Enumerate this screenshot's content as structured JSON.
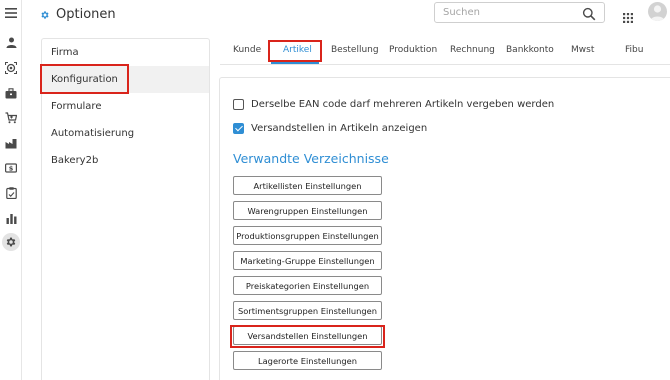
{
  "header": {
    "title": "Optionen",
    "search_placeholder": "Suchen"
  },
  "rail_icons": [
    "menu-icon",
    "person-icon",
    "target-icon",
    "briefcase-icon",
    "cart-icon",
    "factory-icon",
    "money-icon",
    "clipboard-icon",
    "bar-chart-icon",
    "gear-icon"
  ],
  "menu": {
    "items": [
      {
        "label": "Firma"
      },
      {
        "label": "Konfiguration"
      },
      {
        "label": "Formulare"
      },
      {
        "label": "Automatisierung"
      },
      {
        "label": "Bakery2b"
      }
    ],
    "selected": "Konfiguration"
  },
  "tabs": [
    {
      "label": "Kunde"
    },
    {
      "label": "Artikel"
    },
    {
      "label": "Bestellung"
    },
    {
      "label": "Produktion"
    },
    {
      "label": "Rechnung"
    },
    {
      "label": "Bankkonto"
    },
    {
      "label": "Mwst"
    },
    {
      "label": "Fibu"
    }
  ],
  "active_tab": "Artikel",
  "settings": {
    "checkboxes": [
      {
        "label": "Derselbe EAN code darf mehreren Artikeln vergeben werden",
        "checked": false
      },
      {
        "label": "Versandstellen in Artikeln anzeigen",
        "checked": true
      }
    ],
    "section_title": "Verwandte Verzeichnisse",
    "buttons": [
      {
        "label": "Artikellisten Einstellungen"
      },
      {
        "label": "Warengruppen Einstellungen"
      },
      {
        "label": "Produktionsgruppen Einstellungen"
      },
      {
        "label": "Marketing-Gruppe Einstellungen"
      },
      {
        "label": "Preiskategorien Einstellungen"
      },
      {
        "label": "Sortimentsgruppen Einstellungen"
      },
      {
        "label": "Versandstellen Einstellungen"
      },
      {
        "label": "Lagerorte Einstellungen"
      }
    ]
  },
  "colors": {
    "accent": "#2f8ed4",
    "highlight": "#d9241b",
    "icon": "#4a4a4a"
  }
}
